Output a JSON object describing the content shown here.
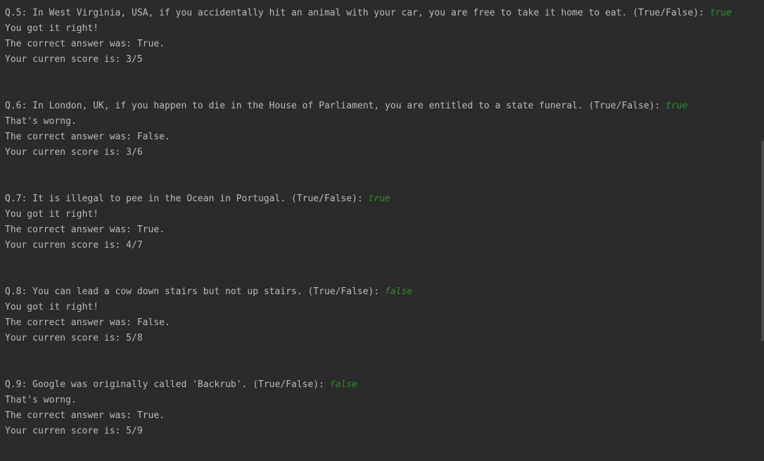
{
  "colors": {
    "background": "#2b2b2b",
    "text": "#bbbbbb",
    "user_input": "#2f8d2f"
  },
  "questions": [
    {
      "prompt": "Q.5: In West Virginia, USA, if you accidentally hit an animal with your car, you are free to take it home to eat. (True/False): ",
      "answer": "true",
      "result": "You got it right!",
      "correct": "The correct answer was: True.",
      "score": "Your curren score is: 3/5"
    },
    {
      "prompt": "Q.6: In London, UK, if you happen to die in the House of Parliament, you are entitled to a state funeral. (True/False): ",
      "answer": "true",
      "result": "That's worng.",
      "correct": "The correct answer was: False.",
      "score": "Your curren score is: 3/6"
    },
    {
      "prompt": "Q.7: It is illegal to pee in the Ocean in Portugal. (True/False): ",
      "answer": "true",
      "result": "You got it right!",
      "correct": "The correct answer was: True.",
      "score": "Your curren score is: 4/7"
    },
    {
      "prompt": "Q.8: You can lead a cow down stairs but not up stairs. (True/False): ",
      "answer": "false",
      "result": "You got it right!",
      "correct": "The correct answer was: False.",
      "score": "Your curren score is: 5/8"
    },
    {
      "prompt": "Q.9: Google was originally called 'Backrub'. (True/False): ",
      "answer": "false",
      "result": "That's worng.",
      "correct": "The correct answer was: True.",
      "score": "Your curren score is: 5/9"
    }
  ]
}
